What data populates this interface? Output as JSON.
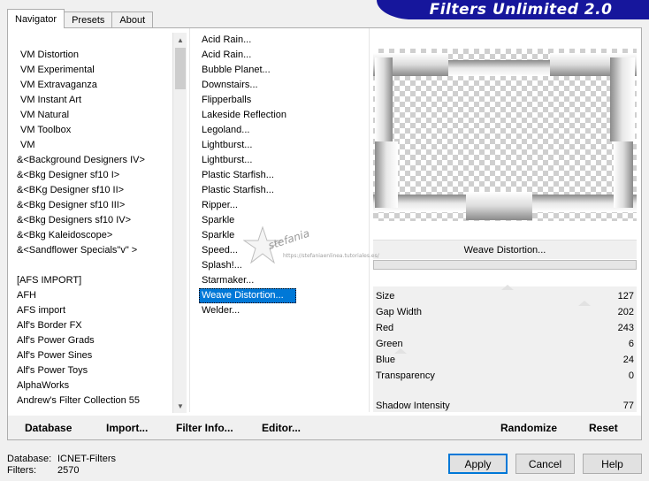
{
  "tabs": [
    "Navigator",
    "Presets",
    "About"
  ],
  "app_title": "Filters Unlimited 2.0",
  "categories": [
    "VM Distortion",
    "VM Experimental",
    "VM Extravaganza",
    "VM Instant Art",
    "VM Natural",
    "VM Toolbox",
    "VM",
    "&<Background Designers IV>",
    "&<Bkg Designer sf10 I>",
    "&<BKg Designer sf10 II>",
    "&<Bkg Designer sf10 III>",
    "&<Bkg Designers sf10 IV>",
    "&<Bkg Kaleidoscope>",
    "&<Sandflower Specials\"v\" >",
    "",
    "[AFS IMPORT]",
    "AFH",
    "AFS import",
    "Alf's Border FX",
    "Alf's Power Grads",
    "Alf's Power Sines",
    "Alf's Power Toys",
    "AlphaWorks",
    "Andrew's Filter Collection 55"
  ],
  "filters": [
    "Acid Rain...",
    "Acid Rain...",
    "Bubble Planet...",
    "Downstairs...",
    "Flipperballs",
    "Lakeside Reflection",
    "Legoland...",
    "Lightburst...",
    "Lightburst...",
    "Plastic Starfish...",
    "Plastic Starfish...",
    "Ripper...",
    "Sparkle",
    "Sparkle",
    "Speed...",
    "Splash!...",
    "Starmaker...",
    "Weave Distortion...",
    "Welder..."
  ],
  "selected_filter": "Weave Distortion...",
  "current_filter_name": "Weave Distortion...",
  "params": [
    {
      "label": "Size",
      "value": "127"
    },
    {
      "label": "Gap Width",
      "value": "202"
    },
    {
      "label": "Red",
      "value": "243"
    },
    {
      "label": "Green",
      "value": "6"
    },
    {
      "label": "Blue",
      "value": "24"
    },
    {
      "label": "Transparency",
      "value": "0"
    },
    {
      "label": "Shadow Intensity",
      "value": "77"
    }
  ],
  "bottom_buttons": {
    "database": "Database",
    "import": "Import...",
    "filter_info": "Filter Info...",
    "editor": "Editor...",
    "randomize": "Randomize",
    "reset": "Reset"
  },
  "info": {
    "database_label": "Database:",
    "database_value": "ICNET-Filters",
    "filters_label": "Filters:",
    "filters_value": "2570"
  },
  "dialog_buttons": {
    "apply": "Apply",
    "cancel": "Cancel",
    "help": "Help"
  },
  "watermark": {
    "text": "stefania",
    "url": "https://stefaniaenlinea.tutoriales.es/"
  }
}
